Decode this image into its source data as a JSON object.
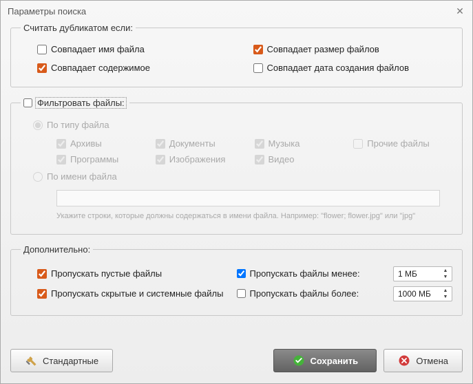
{
  "window": {
    "title": "Параметры поиска"
  },
  "dup": {
    "legend": "Считать дубликатом если:",
    "same_name": {
      "label": "Совпадает имя файла",
      "checked": false
    },
    "same_size": {
      "label": "Совпадает размер файлов",
      "checked": true
    },
    "same_content": {
      "label": "Совпадает содержимое",
      "checked": true
    },
    "same_date": {
      "label": "Совпадает дата создания файлов",
      "checked": false
    }
  },
  "filter": {
    "enable_label": "Фильтровать файлы:",
    "enabled": false,
    "by_type": {
      "label": "По типу файла",
      "selected": true
    },
    "by_name": {
      "label": "По имени файла",
      "selected": false
    },
    "types": {
      "archives": {
        "label": "Архивы",
        "checked": true
      },
      "documents": {
        "label": "Документы",
        "checked": true
      },
      "music": {
        "label": "Музыка",
        "checked": true
      },
      "other": {
        "label": "Прочие файлы",
        "checked": false
      },
      "programs": {
        "label": "Программы",
        "checked": true
      },
      "images": {
        "label": "Изображения",
        "checked": true
      },
      "video": {
        "label": "Видео",
        "checked": true
      }
    },
    "name_hint": "Укажите строки, которые должны содержаться в имени файла. Например: \"flower; flower.jpg\" или \"jpg\""
  },
  "addl": {
    "legend": "Дополнительно:",
    "skip_empty": {
      "label": "Пропускать пустые файлы",
      "checked": true
    },
    "skip_hidden": {
      "label": "Пропускать скрытые и системные файлы",
      "checked": true
    },
    "skip_less": {
      "label": "Пропускать файлы менее:",
      "checked": true,
      "value": "1 МБ"
    },
    "skip_more": {
      "label": "Пропускать файлы более:",
      "checked": false,
      "value": "1000 МБ"
    }
  },
  "buttons": {
    "defaults": "Стандартные",
    "save": "Сохранить",
    "cancel": "Отмена"
  }
}
